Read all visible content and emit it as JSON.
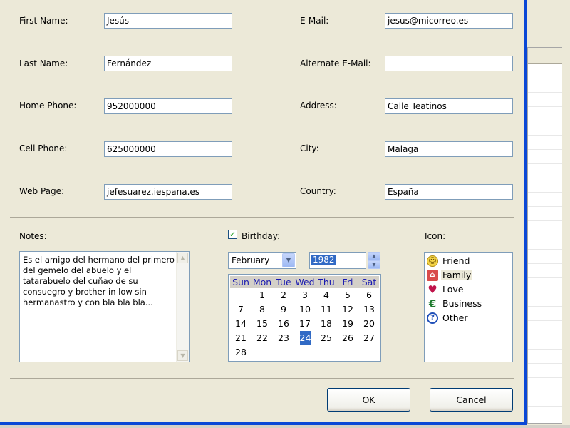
{
  "form": {
    "left": [
      {
        "label": "First Name:",
        "value": "Jesús"
      },
      {
        "label": "Last Name:",
        "value": "Fernández"
      },
      {
        "label": "Home Phone:",
        "value": "952000000"
      },
      {
        "label": "Cell Phone:",
        "value": "625000000"
      },
      {
        "label": "Web Page:",
        "value": "jefesuarez.iespana.es"
      }
    ],
    "right": [
      {
        "label": "E-Mail:",
        "value": "jesus@micorreo.es"
      },
      {
        "label": "Alternate E-Mail:",
        "value": ""
      },
      {
        "label": "Address:",
        "value": "Calle Teatinos"
      },
      {
        "label": "City:",
        "value": "Malaga"
      },
      {
        "label": "Country:",
        "value": "España"
      }
    ]
  },
  "notes": {
    "label": "Notes:",
    "lines": [
      "Es el amigo del hermano del primero",
      "del gemelo del abuelo y el",
      "tatarabuelo del cuñao de su",
      "consuegro y brother in low sin",
      "hermanastro y con bla bla bla..."
    ]
  },
  "birthday": {
    "label": "Birthday:",
    "checked": true,
    "month": "February",
    "year": "1982",
    "day_headers": [
      "Sun",
      "Mon",
      "Tue",
      "Wed",
      "Thu",
      "Fri",
      "Sat"
    ],
    "weeks": [
      [
        "",
        "1",
        "2",
        "3",
        "4",
        "5",
        "6"
      ],
      [
        "7",
        "8",
        "9",
        "10",
        "11",
        "12",
        "13"
      ],
      [
        "14",
        "15",
        "16",
        "17",
        "18",
        "19",
        "20"
      ],
      [
        "21",
        "22",
        "23",
        "24",
        "25",
        "26",
        "27"
      ],
      [
        "28",
        "",
        "",
        "",
        "",
        "",
        ""
      ]
    ],
    "selected_day": "24"
  },
  "icon_panel": {
    "label": "Icon:",
    "items": [
      {
        "label": "Friend",
        "icon": "smiley-icon"
      },
      {
        "label": "Family",
        "icon": "house-icon"
      },
      {
        "label": "Love",
        "icon": "heart-icon"
      },
      {
        "label": "Business",
        "icon": "euro-icon"
      },
      {
        "label": "Other",
        "icon": "question-icon"
      }
    ],
    "selected": "Family"
  },
  "buttons": {
    "ok": "OK",
    "cancel": "Cancel"
  },
  "colors": {
    "dialog_bg": "#ece9d8",
    "frame_blue": "#0a47d6",
    "selection_blue": "#316ac5"
  }
}
